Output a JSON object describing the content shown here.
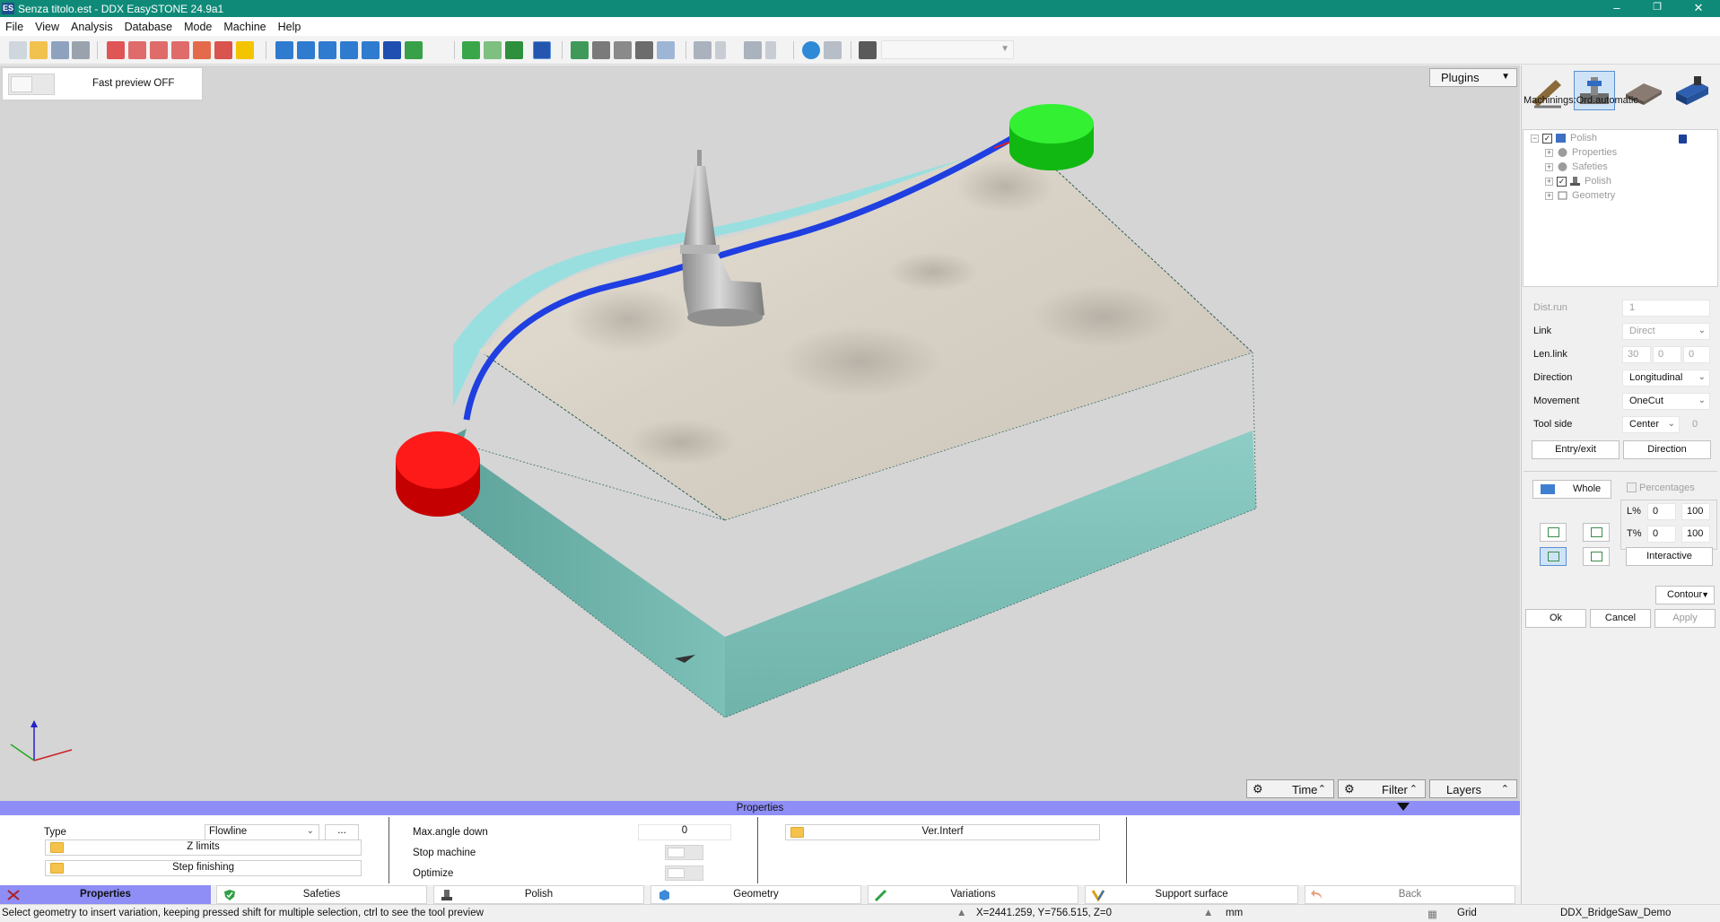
{
  "window": {
    "app_icon": "ES",
    "title": "Senza titolo.est - DDX EasySTONE 24.9a1",
    "controls": {
      "minimize": "–",
      "maximize": "❐",
      "close": "✕"
    }
  },
  "menu": [
    "File",
    "View",
    "Analysis",
    "Database",
    "Mode",
    "Machine",
    "Help"
  ],
  "toolbar": {
    "groups": [
      [
        "new-file-icon",
        "open-file-icon",
        "save-icon",
        "print-icon"
      ],
      [
        "zoom-window-icon",
        "zoom-in-icon",
        "zoom-out-icon",
        "zoom-all-icon",
        "pan-hand-icon",
        "rotate-icon",
        "light-bulb-icon"
      ],
      [
        "view-front-icon",
        "view-back-icon",
        "view-left-icon",
        "view-right-icon",
        "view-top-icon",
        "view-iso-icon",
        "view-axis-icon"
      ],
      [
        "shield-check-icon",
        "shield-outline-icon",
        "shield-green-icon",
        "shield-blue-icon"
      ],
      [
        "monitor-icon",
        "machine-icon",
        "tool-path-icon",
        "crossed-tools-icon",
        "document-icon"
      ],
      [
        "undo-icon",
        "undo-dropdown-icon",
        "redo-icon",
        "redo-dropdown-icon"
      ],
      [
        "user-icon",
        "mail-icon",
        "license-icon"
      ]
    ],
    "combo_value": ""
  },
  "viewport": {
    "fast_preview_label": "Fast preview OFF",
    "plugins_label": "Plugins",
    "bottom_buttons": {
      "time": "Time",
      "filter": "Filter",
      "layers": "Layers"
    }
  },
  "right_panel": {
    "tool_icons": [
      "pencil-tool-icon",
      "polish-machine-icon",
      "stone-slab-icon",
      "truck-icon"
    ],
    "machinings_label": "Machinings:Ord.automatic",
    "tree": [
      {
        "label": "Polish",
        "level": 0,
        "checked": true
      },
      {
        "label": "Properties",
        "level": 1
      },
      {
        "label": "Safeties",
        "level": 1
      },
      {
        "label": "Polish",
        "level": 1,
        "checked": true
      },
      {
        "label": "Geometry",
        "level": 1
      }
    ],
    "dist_run": {
      "label": "Dist.run",
      "value": "1"
    },
    "link": {
      "label": "Link",
      "value": "Direct"
    },
    "len_link": {
      "label": "Len.link",
      "v1": "30",
      "v2": "0",
      "v3": "0"
    },
    "direction": {
      "label": "Direction",
      "value": "Longitudinal"
    },
    "movement": {
      "label": "Movement",
      "value": "OneCut"
    },
    "tool_side": {
      "label": "Tool side",
      "value": "Center",
      "extra": "0"
    },
    "entry_exit_btn": "Entry/exit",
    "direction_btn": "Direction",
    "whole_btn": "Whole",
    "percentages_label": "Percentages",
    "l_pct": {
      "label": "L%",
      "from": "0",
      "to": "100"
    },
    "t_pct": {
      "label": "T%",
      "from": "0",
      "to": "100"
    },
    "interactive_btn": "Interactive",
    "contour": "Contour",
    "ok": "Ok",
    "cancel": "Cancel",
    "apply": "Apply"
  },
  "properties": {
    "header": "Properties",
    "type_label": "Type",
    "type_value": "Flowline",
    "type_more": "...",
    "z_limits": "Z limits",
    "step_finishing": "Step finishing",
    "max_angle_label": "Max.angle down",
    "max_angle_value": "0",
    "stop_machine_label": "Stop machine",
    "optimize_label": "Optimize",
    "ver_interf": "Ver.Interf"
  },
  "tabs": [
    {
      "label": "Properties",
      "icon": "tools-icon",
      "active": true
    },
    {
      "label": "Safeties",
      "icon": "shield-check-icon"
    },
    {
      "label": "Polish",
      "icon": "polish-head-icon"
    },
    {
      "label": "Geometry",
      "icon": "cube-icon"
    },
    {
      "label": "Variations",
      "icon": "pencil-line-icon"
    },
    {
      "label": "Support surface",
      "icon": "support-icon"
    },
    {
      "label": "Back",
      "icon": "back-arrow-icon"
    }
  ],
  "status": {
    "hint": "Select geometry to insert variation, keeping pressed shift for multiple selection, ctrl to see the tool preview",
    "coords": "X=2441.259, Y=756.515, Z=0",
    "units": "mm",
    "grid": "Grid",
    "machine": "DDX_BridgeSaw_Demo"
  },
  "colors": {
    "titlebar": "#0f8a78",
    "properties_header": "#8e8ef6",
    "viewport_bg": "#d5d5d5",
    "slab_side": "#79c4bc",
    "start_marker": "#ff1a1a",
    "end_marker": "#1ee51e",
    "toolpath": "#1f3fe0"
  }
}
